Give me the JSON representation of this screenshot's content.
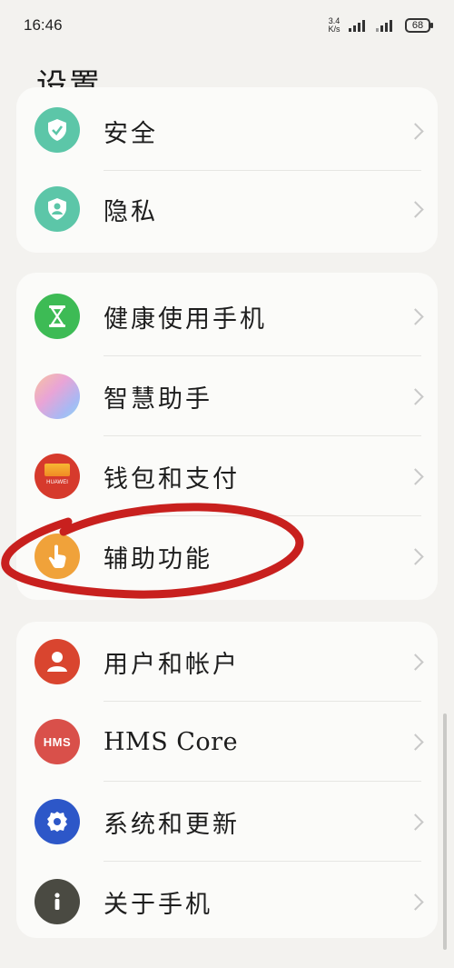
{
  "status_bar": {
    "time": "16:46",
    "net_speed_value": "3.4",
    "net_speed_unit": "K/s",
    "battery": "68"
  },
  "header": {
    "title": "设置"
  },
  "groups": [
    {
      "items": [
        {
          "label": "安全",
          "icon": "shield-check-icon",
          "color": "#5cc6a8"
        },
        {
          "label": "隐私",
          "icon": "privacy-shield-icon",
          "color": "#5cc6a8"
        }
      ]
    },
    {
      "items": [
        {
          "label": "健康使用手机",
          "icon": "hourglass-icon",
          "color": "#3dbb55"
        },
        {
          "label": "智慧助手",
          "icon": "smart-assistant-icon",
          "color": "#c9a7e8"
        },
        {
          "label": "钱包和支付",
          "icon": "huawei-wallet-icon",
          "color": "#d63a2c",
          "icon_text": "HUAWEI"
        },
        {
          "label": "辅助功能",
          "icon": "hand-tap-icon",
          "color": "#f0a23a"
        }
      ]
    },
    {
      "items": [
        {
          "label": "用户和帐户",
          "icon": "user-icon",
          "color": "#d9452f"
        },
        {
          "label": "HMS Core",
          "icon": "hms-icon",
          "color": "#d9504a",
          "icon_text": "HMS"
        },
        {
          "label": "系统和更新",
          "icon": "gear-icon",
          "color": "#2d57c8"
        },
        {
          "label": "关于手机",
          "icon": "info-icon",
          "color": "#4a4a42"
        }
      ]
    }
  ],
  "annotation_color": "#c8201e"
}
